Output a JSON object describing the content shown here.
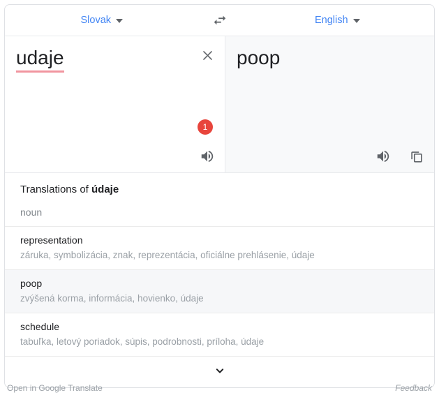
{
  "languages": {
    "source": "Slovak",
    "target": "English",
    "swap_icon": "swap-horizontal-icon"
  },
  "source_pane": {
    "text": "udaje",
    "misspelled": true,
    "clear_icon": "close-icon",
    "listen_icon": "volume-up-icon",
    "badge_count": "1"
  },
  "target_pane": {
    "text": "poop",
    "listen_icon": "volume-up-icon",
    "copy_icon": "copy-icon"
  },
  "translations": {
    "header_prefix": "Translations of ",
    "header_word": "údaje",
    "part_of_speech": "noun",
    "rows": [
      {
        "word": "representation",
        "synonyms": "záruka, symbolizácia, znak, reprezentácia, oficiálne prehlásenie, údaje",
        "active": false
      },
      {
        "word": "poop",
        "synonyms": "zvýšená korma, informácia, hovienko, údaje",
        "active": true
      },
      {
        "word": "schedule",
        "synonyms": "tabuľka, letový poriadok, súpis, podrobnosti, príloha, údaje",
        "active": false
      }
    ],
    "expand_icon": "chevron-down-icon"
  },
  "footer": {
    "open_link": "Open in Google Translate",
    "feedback": "Feedback"
  },
  "colors": {
    "accent_blue": "#4285f4",
    "badge_red": "#e8453c",
    "spellcheck_pink": "#f1959f",
    "target_bg": "#f8f9fa"
  }
}
